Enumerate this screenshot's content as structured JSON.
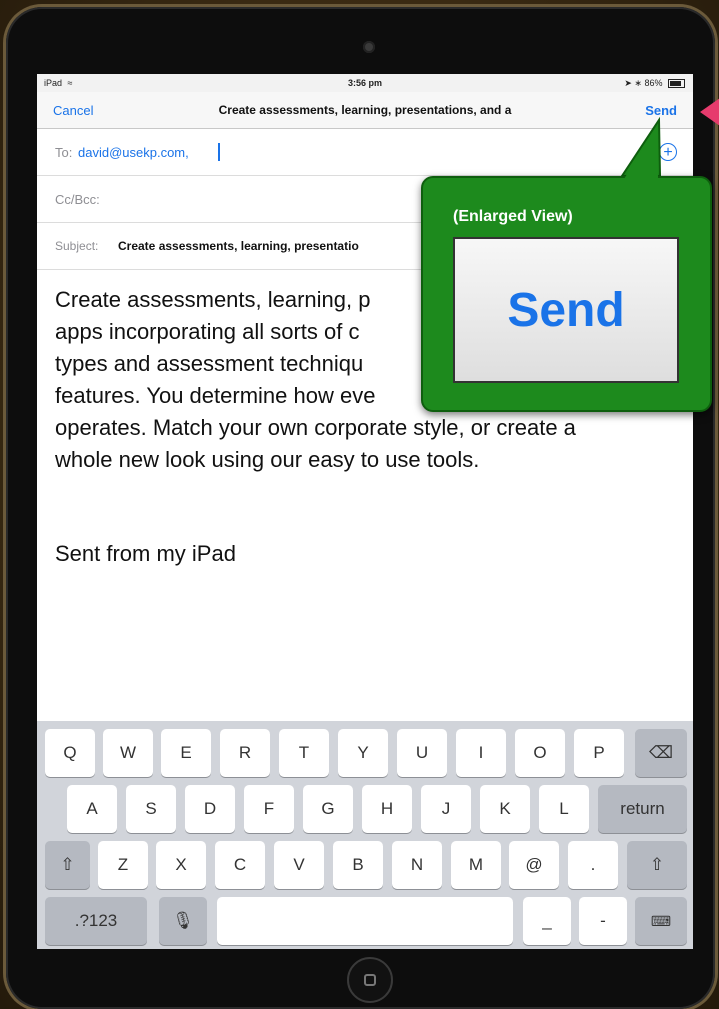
{
  "status_bar": {
    "device": "iPad",
    "time": "3:56 pm",
    "battery": "86%"
  },
  "nav": {
    "cancel": "Cancel",
    "title": "Create assessments, learning, presentations, and a",
    "send": "Send"
  },
  "to_field": {
    "label": "To:",
    "value": "david@usekp.com,"
  },
  "cc_field": {
    "label": "Cc/Bcc:"
  },
  "subject_field": {
    "label": "Subject:",
    "value": "Create assessments, learning, presentatio"
  },
  "body": {
    "lines": [
      "Create assessments, learning, p",
      "apps incorporating all sorts of c",
      "types and assessment techniqu",
      "features. You determine how eve",
      "operates. Match your own corporate style, or create a",
      "whole new look using our easy to use tools."
    ],
    "signature": "Sent from my iPad"
  },
  "callout": {
    "title": "(Enlarged View)",
    "text": "Send"
  },
  "keyboard": {
    "row1": [
      "Q",
      "W",
      "E",
      "R",
      "T",
      "Y",
      "U",
      "I",
      "O",
      "P"
    ],
    "row2": [
      "A",
      "S",
      "D",
      "F",
      "G",
      "H",
      "J",
      "K",
      "L"
    ],
    "return": "return",
    "row3": [
      "Z",
      "X",
      "C",
      "V",
      "B",
      "N",
      "M",
      "@",
      "."
    ],
    "numbers": ".?123",
    "underscore": "_",
    "dash": "-"
  },
  "colors": {
    "accent": "#1a73e8",
    "callout": "#1d8a1d",
    "pointer": "#e63b6d"
  },
  "icons": {
    "plus": "plus-circle-icon",
    "backspace": "backspace-icon",
    "shift": "shift-icon",
    "mic": "microphone-icon",
    "hide_keyboard": "keyboard-hide-icon",
    "wifi": "wifi-icon",
    "location": "location-arrow-icon",
    "bluetooth": "bluetooth-icon",
    "battery": "battery-icon"
  }
}
